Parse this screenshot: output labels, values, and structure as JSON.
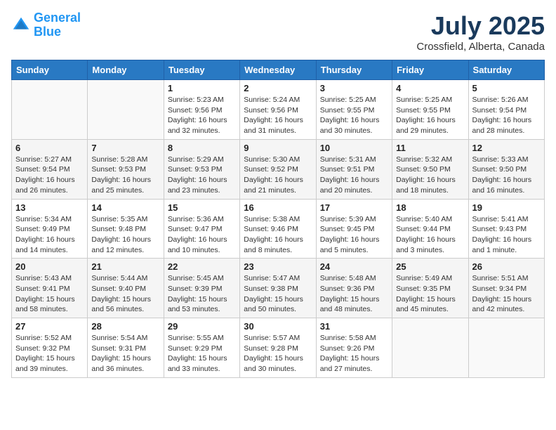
{
  "header": {
    "logo_line1": "General",
    "logo_line2": "Blue",
    "month_title": "July 2025",
    "location": "Crossfield, Alberta, Canada"
  },
  "weekdays": [
    "Sunday",
    "Monday",
    "Tuesday",
    "Wednesday",
    "Thursday",
    "Friday",
    "Saturday"
  ],
  "weeks": [
    [
      {
        "day": "",
        "info": ""
      },
      {
        "day": "",
        "info": ""
      },
      {
        "day": "1",
        "info": "Sunrise: 5:23 AM\nSunset: 9:56 PM\nDaylight: 16 hours\nand 32 minutes."
      },
      {
        "day": "2",
        "info": "Sunrise: 5:24 AM\nSunset: 9:56 PM\nDaylight: 16 hours\nand 31 minutes."
      },
      {
        "day": "3",
        "info": "Sunrise: 5:25 AM\nSunset: 9:55 PM\nDaylight: 16 hours\nand 30 minutes."
      },
      {
        "day": "4",
        "info": "Sunrise: 5:25 AM\nSunset: 9:55 PM\nDaylight: 16 hours\nand 29 minutes."
      },
      {
        "day": "5",
        "info": "Sunrise: 5:26 AM\nSunset: 9:54 PM\nDaylight: 16 hours\nand 28 minutes."
      }
    ],
    [
      {
        "day": "6",
        "info": "Sunrise: 5:27 AM\nSunset: 9:54 PM\nDaylight: 16 hours\nand 26 minutes."
      },
      {
        "day": "7",
        "info": "Sunrise: 5:28 AM\nSunset: 9:53 PM\nDaylight: 16 hours\nand 25 minutes."
      },
      {
        "day": "8",
        "info": "Sunrise: 5:29 AM\nSunset: 9:53 PM\nDaylight: 16 hours\nand 23 minutes."
      },
      {
        "day": "9",
        "info": "Sunrise: 5:30 AM\nSunset: 9:52 PM\nDaylight: 16 hours\nand 21 minutes."
      },
      {
        "day": "10",
        "info": "Sunrise: 5:31 AM\nSunset: 9:51 PM\nDaylight: 16 hours\nand 20 minutes."
      },
      {
        "day": "11",
        "info": "Sunrise: 5:32 AM\nSunset: 9:50 PM\nDaylight: 16 hours\nand 18 minutes."
      },
      {
        "day": "12",
        "info": "Sunrise: 5:33 AM\nSunset: 9:50 PM\nDaylight: 16 hours\nand 16 minutes."
      }
    ],
    [
      {
        "day": "13",
        "info": "Sunrise: 5:34 AM\nSunset: 9:49 PM\nDaylight: 16 hours\nand 14 minutes."
      },
      {
        "day": "14",
        "info": "Sunrise: 5:35 AM\nSunset: 9:48 PM\nDaylight: 16 hours\nand 12 minutes."
      },
      {
        "day": "15",
        "info": "Sunrise: 5:36 AM\nSunset: 9:47 PM\nDaylight: 16 hours\nand 10 minutes."
      },
      {
        "day": "16",
        "info": "Sunrise: 5:38 AM\nSunset: 9:46 PM\nDaylight: 16 hours\nand 8 minutes."
      },
      {
        "day": "17",
        "info": "Sunrise: 5:39 AM\nSunset: 9:45 PM\nDaylight: 16 hours\nand 5 minutes."
      },
      {
        "day": "18",
        "info": "Sunrise: 5:40 AM\nSunset: 9:44 PM\nDaylight: 16 hours\nand 3 minutes."
      },
      {
        "day": "19",
        "info": "Sunrise: 5:41 AM\nSunset: 9:43 PM\nDaylight: 16 hours\nand 1 minute."
      }
    ],
    [
      {
        "day": "20",
        "info": "Sunrise: 5:43 AM\nSunset: 9:41 PM\nDaylight: 15 hours\nand 58 minutes."
      },
      {
        "day": "21",
        "info": "Sunrise: 5:44 AM\nSunset: 9:40 PM\nDaylight: 15 hours\nand 56 minutes."
      },
      {
        "day": "22",
        "info": "Sunrise: 5:45 AM\nSunset: 9:39 PM\nDaylight: 15 hours\nand 53 minutes."
      },
      {
        "day": "23",
        "info": "Sunrise: 5:47 AM\nSunset: 9:38 PM\nDaylight: 15 hours\nand 50 minutes."
      },
      {
        "day": "24",
        "info": "Sunrise: 5:48 AM\nSunset: 9:36 PM\nDaylight: 15 hours\nand 48 minutes."
      },
      {
        "day": "25",
        "info": "Sunrise: 5:49 AM\nSunset: 9:35 PM\nDaylight: 15 hours\nand 45 minutes."
      },
      {
        "day": "26",
        "info": "Sunrise: 5:51 AM\nSunset: 9:34 PM\nDaylight: 15 hours\nand 42 minutes."
      }
    ],
    [
      {
        "day": "27",
        "info": "Sunrise: 5:52 AM\nSunset: 9:32 PM\nDaylight: 15 hours\nand 39 minutes."
      },
      {
        "day": "28",
        "info": "Sunrise: 5:54 AM\nSunset: 9:31 PM\nDaylight: 15 hours\nand 36 minutes."
      },
      {
        "day": "29",
        "info": "Sunrise: 5:55 AM\nSunset: 9:29 PM\nDaylight: 15 hours\nand 33 minutes."
      },
      {
        "day": "30",
        "info": "Sunrise: 5:57 AM\nSunset: 9:28 PM\nDaylight: 15 hours\nand 30 minutes."
      },
      {
        "day": "31",
        "info": "Sunrise: 5:58 AM\nSunset: 9:26 PM\nDaylight: 15 hours\nand 27 minutes."
      },
      {
        "day": "",
        "info": ""
      },
      {
        "day": "",
        "info": ""
      }
    ]
  ]
}
